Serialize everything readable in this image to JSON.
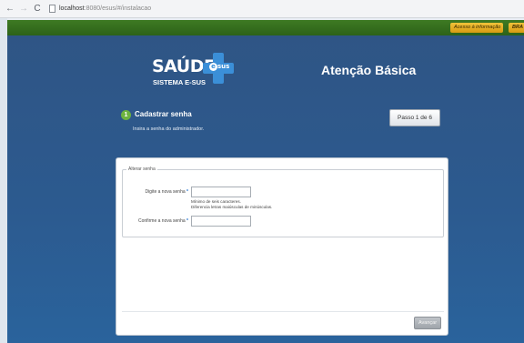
{
  "browser": {
    "back": "←",
    "forward": "→",
    "reload": "C",
    "url_host": "localhost",
    "url_rest": ":8080/esus/#/instalacao"
  },
  "top_links": {
    "info": "Acesso à informação",
    "brasil": "BRA"
  },
  "logo": {
    "title": "SAÚDE",
    "badge": "sus",
    "subtitle": "SISTEMA E-SUS"
  },
  "header": {
    "title": "Atenção Básica"
  },
  "step": {
    "number": "1",
    "title": "Cadastrar senha",
    "description": "Insira a senha do administrador.",
    "progress": "Passo 1 de 6"
  },
  "form": {
    "legend": "Alterar senha",
    "new_password_label": "Digite a nova senha",
    "required_mark": "*",
    "hint_line1": "Mínimo de seis caracteres.",
    "hint_line2": "Diferencia letras maiúsculas de minúsculas.",
    "confirm_label": "Confirme a nova senha",
    "next_button": "Avançar"
  }
}
